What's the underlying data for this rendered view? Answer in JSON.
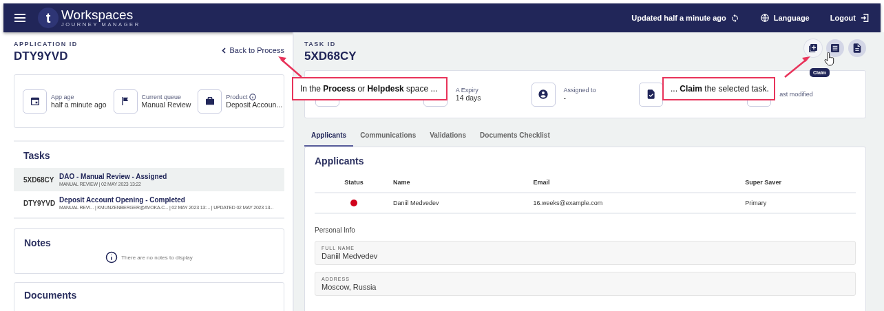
{
  "header": {
    "logo_letter": "t",
    "logo_title": "Workspaces",
    "logo_subtitle": "JOURNEY MANAGER",
    "updated": "Updated half a minute ago",
    "language": "Language",
    "logout": "Logout"
  },
  "application": {
    "id_label": "APPLICATION ID",
    "id": "DTY9YVD",
    "back_link": "Back to Process",
    "summary": [
      {
        "kind": "calendar",
        "label": "App age",
        "value": "half a minute ago",
        "info": false
      },
      {
        "kind": "flag",
        "label": "Current queue",
        "value": "Manual Review",
        "info": false
      },
      {
        "kind": "briefcase",
        "label": "Product",
        "value": "Deposit Accoun...",
        "info": true
      }
    ]
  },
  "tasks": {
    "title": "Tasks",
    "items": [
      {
        "id": "5XD68CY",
        "title": "DAO - Manual Review - Assigned",
        "meta": "MANUAL REVIEW | 02 MAY 2023 13:22",
        "selected": true
      },
      {
        "id": "DTY9YVD",
        "title": "Deposit Account Opening - Completed",
        "meta": "MANUAL REVI...  | KMUNZENBERGER@AVOKA.C...  | 02 MAY 2023 13:...  | UPDATED 02 MAY 2023 13...",
        "selected": false
      }
    ]
  },
  "notes": {
    "title": "Notes",
    "empty_message": "There are no notes to display"
  },
  "documents": {
    "title": "Documents"
  },
  "task": {
    "id_label": "TASK ID",
    "id": "5XD68CY",
    "actions": [
      {
        "kind": "claim",
        "tooltip": "Claim"
      },
      {
        "kind": "list"
      },
      {
        "kind": "document"
      }
    ],
    "summary": [
      {
        "kind": "empty"
      },
      {
        "kind": "empty",
        "label": "A Expiry",
        "value": "14 days"
      },
      {
        "kind": "user",
        "label": "Assigned to",
        "value": "-"
      },
      {
        "kind": "doc-check"
      },
      {
        "kind": "empty",
        "label": "ast modified"
      }
    ]
  },
  "tabs": [
    {
      "label": "Applicants",
      "selected": true
    },
    {
      "label": "Communications",
      "selected": false
    },
    {
      "label": "Validations",
      "selected": false
    },
    {
      "label": "Documents Checklist",
      "selected": false
    }
  ],
  "applicants": {
    "title": "Applicants",
    "columns": [
      "Status",
      "Name",
      "Email",
      "Super Saver"
    ],
    "rows": [
      {
        "color": "#d0021b",
        "name": "Daniil Medvedev",
        "email": "16.weeks@example.com",
        "super_saver": "Primary"
      }
    ]
  },
  "personal_info": {
    "title": "Personal Info",
    "fields": [
      {
        "label": "FULL NAME",
        "value": "Daniil Medvedev"
      },
      {
        "label": "ADDRESS",
        "value": "Moscow, Russia"
      }
    ]
  },
  "callouts": [
    {
      "text": "In the **Process** or **Helpdesk** space ..."
    },
    {
      "text": "... **Claim** the selected task."
    }
  ]
}
